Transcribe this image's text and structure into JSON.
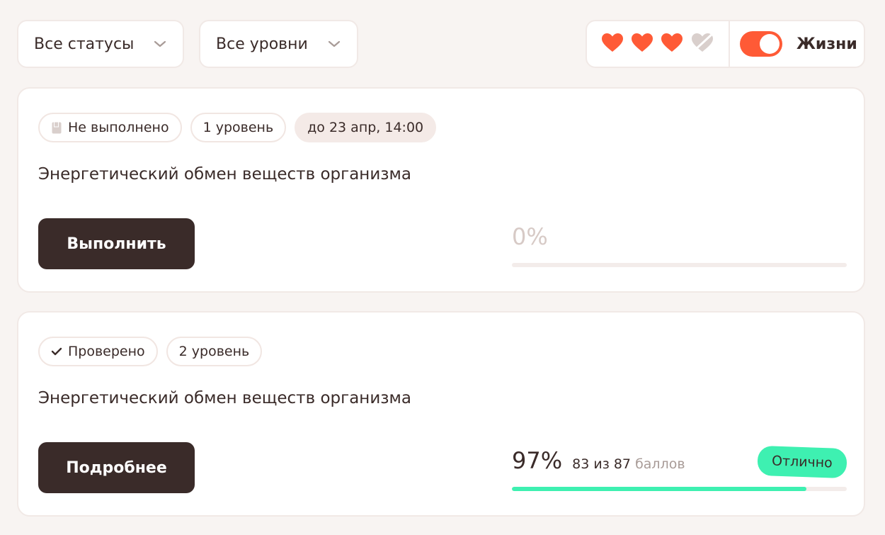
{
  "filters": {
    "status": {
      "selected": "Все статусы"
    },
    "levels": {
      "selected": "Все уровни"
    }
  },
  "lives": {
    "label": "Жизни",
    "enabled": true,
    "hearts_total": 4,
    "hearts_full": 3,
    "heart_color": "#ff5a36",
    "heart_empty_color": "#d9cfcc"
  },
  "cards": [
    {
      "status": "Не выполнено",
      "status_icon": "book-icon",
      "level": "1 уровень",
      "deadline": "до 23 апр, 14:00",
      "title": "Энергетический обмен веществ организма",
      "button": "Выполнить",
      "percent": "0%",
      "progress": 0
    },
    {
      "status": "Проверено",
      "status_icon": "check-icon",
      "level": "2 уровень",
      "title": "Энергетический обмен веществ организма",
      "button": "Подробнее",
      "percent": "97%",
      "score": "83 из 87",
      "score_unit": "баллов",
      "grade": "Отлично",
      "progress": 0.88
    }
  ],
  "colors": {
    "accent": "#ff5a36",
    "success": "#3ef0b1",
    "button_dark": "#3a2b29"
  }
}
